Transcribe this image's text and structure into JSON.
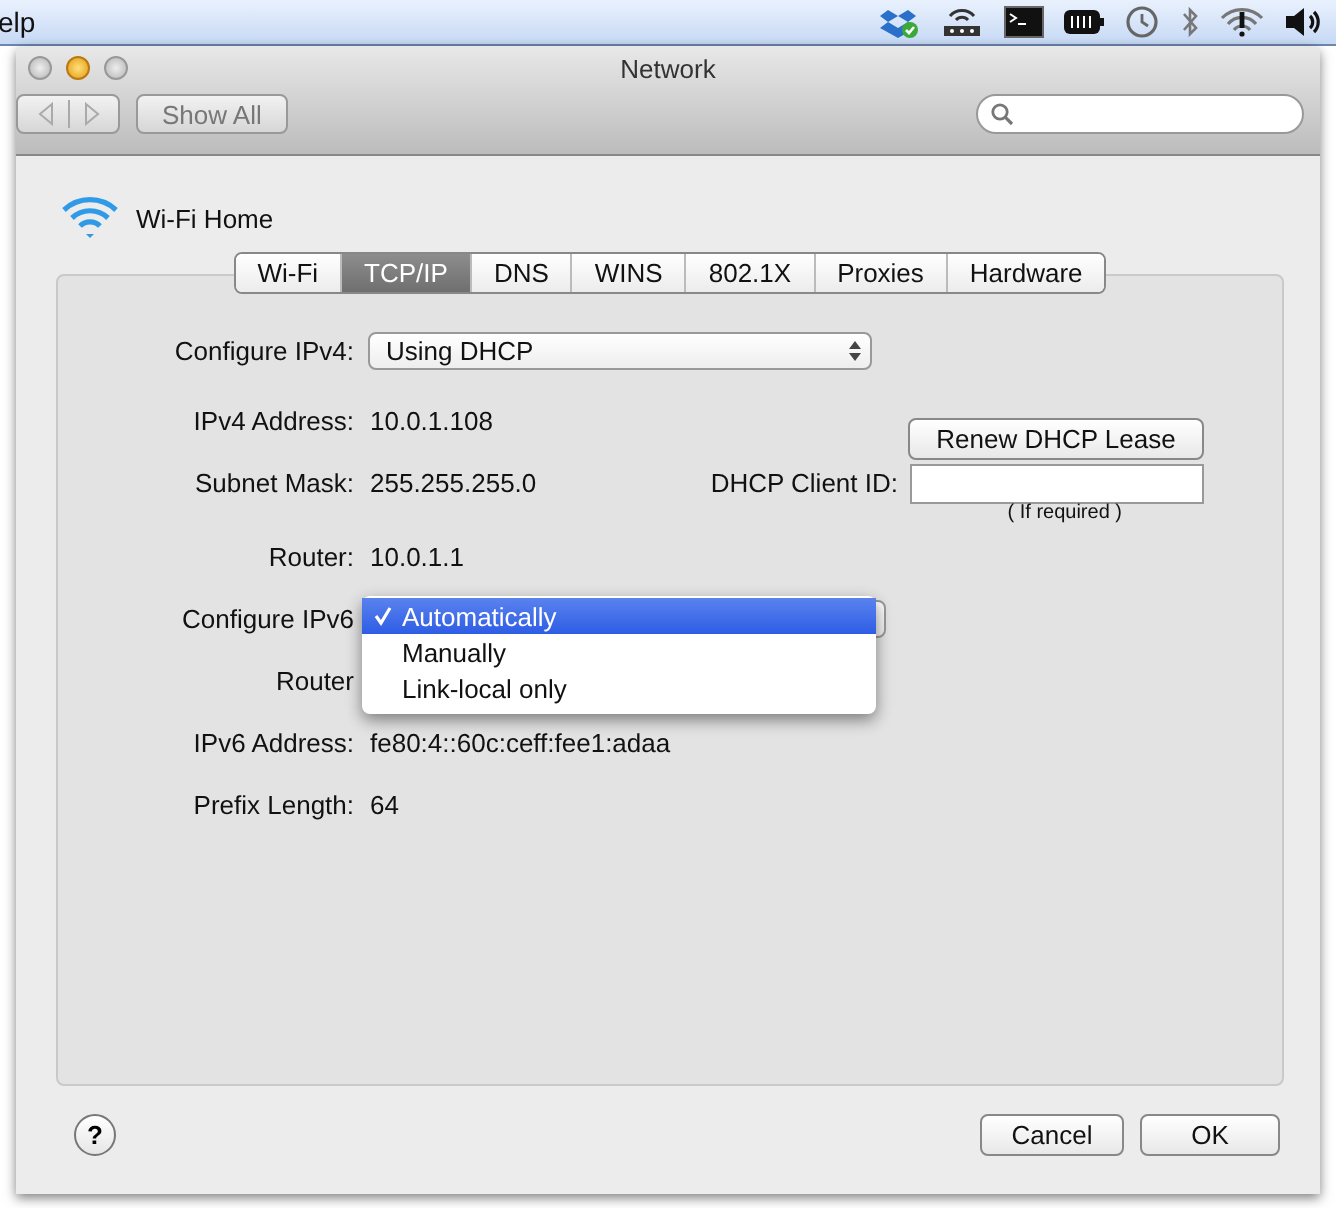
{
  "menu_bar": {
    "app_menu": "elp"
  },
  "window": {
    "title": "Network",
    "show_all": "Show All"
  },
  "sheet": {
    "service": "Wi-Fi Home",
    "tabs": [
      {
        "label": "Wi-Fi",
        "selected": false
      },
      {
        "label": "TCP/IP",
        "selected": true
      },
      {
        "label": "DNS",
        "selected": false
      },
      {
        "label": "WINS",
        "selected": false
      },
      {
        "label": "802.1X",
        "selected": false
      },
      {
        "label": "Proxies",
        "selected": false
      },
      {
        "label": "Hardware",
        "selected": false
      }
    ],
    "ipv4": {
      "configure_label": "Configure IPv4:",
      "configure_value": "Using DHCP",
      "fields": [
        {
          "label": "IPv4 Address:",
          "value": "10.0.1.108"
        },
        {
          "label": "Subnet Mask:",
          "value": "255.255.255.0"
        },
        {
          "label": "Router:",
          "value": "10.0.1.1"
        }
      ],
      "renew_button": "Renew DHCP Lease",
      "client_id_label": "DHCP Client ID:",
      "client_id_note": "( If required )"
    },
    "ipv6": {
      "configure_label": "Configure IPv6",
      "menu": [
        {
          "label": "Automatically",
          "selected": true
        },
        {
          "label": "Manually",
          "selected": false
        },
        {
          "label": "Link-local only",
          "selected": false
        }
      ],
      "router_label": "Router",
      "fields": [
        {
          "label": "IPv6 Address:",
          "value": "fe80:4::60c:ceff:fee1:adaa"
        },
        {
          "label": "Prefix Length:",
          "value": "64"
        }
      ]
    },
    "help_button": "?",
    "buttons": [
      {
        "label": "Cancel",
        "kind": "normal"
      },
      {
        "label": "OK",
        "kind": "default"
      }
    ]
  }
}
